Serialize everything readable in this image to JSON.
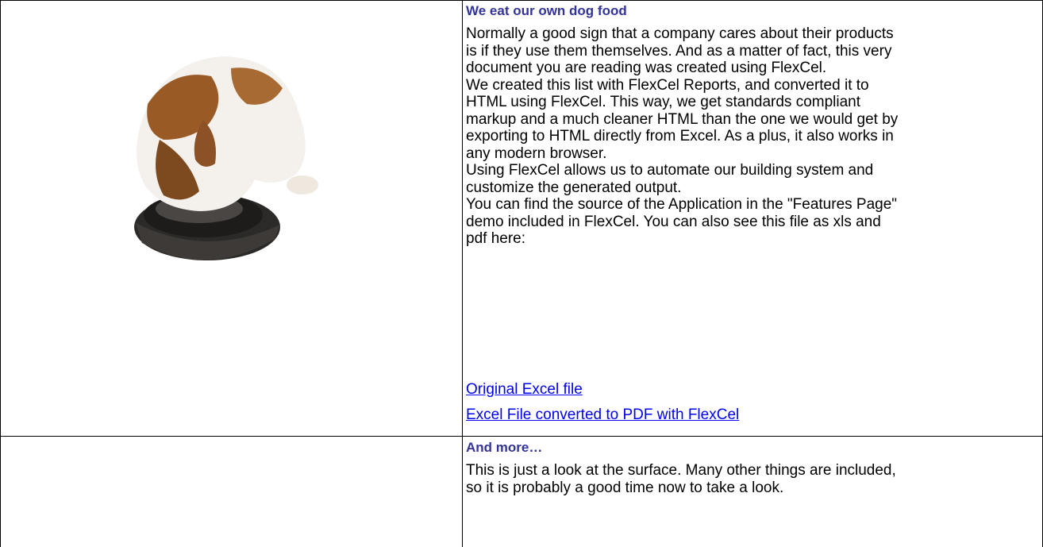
{
  "section1": {
    "heading": "We eat our own dog food",
    "paragraphs": [
      "Normally a good sign that a company cares about their products\nis if they use them themselves. And as a matter of fact, this very\ndocument you are reading was created using FlexCel.",
      "We created this list with FlexCel Reports, and converted it to\nHTML using FlexCel. This way, we get standards compliant\nmarkup and a much cleaner HTML than the one we would get by\nexporting to HTML directly from Excel. As a plus, it also works in\nany modern browser.",
      "Using FlexCel allows us to automate our building system and\ncustomize the generated output.",
      "You can find the source of the Application in the \"Features Page\"\ndemo included in FlexCel. You can also see this file as xls and\npdf here:"
    ],
    "links": [
      "Original Excel file",
      "Excel File converted to PDF with FlexCel"
    ],
    "image_icon": "puppy-eating-from-bowl"
  },
  "section2": {
    "heading": "And more…",
    "paragraph": "This is just a look at the surface. Many other things are included,\nso it is probably a good time now to take a look."
  },
  "colors": {
    "heading": "#333399",
    "link": "#0000ee",
    "border": "#000000"
  }
}
